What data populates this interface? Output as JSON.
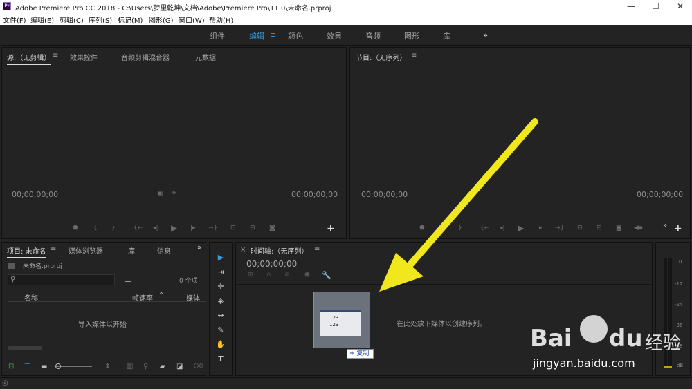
{
  "titlebar": {
    "title": "Adobe Premiere Pro CC 2018 - C:\\Users\\梦里乾坤\\文档\\Adobe\\Premiere Pro\\11.0\\未命名.prproj",
    "minimize": "—",
    "maximize": "☐",
    "close": "✕",
    "app_icon": "Pr"
  },
  "menu": {
    "items": [
      "文件(F)",
      "编辑(E)",
      "剪辑(C)",
      "序列(S)",
      "标记(M)",
      "图形(G)",
      "窗口(W)",
      "帮助(H)"
    ]
  },
  "workspaces": {
    "items": [
      "组件",
      "编辑",
      "颜色",
      "效果",
      "音频",
      "图形",
      "库"
    ],
    "active_index": 1,
    "more": "»",
    "menu_glyph": "≡"
  },
  "source_panel": {
    "tabs": [
      "源:（无剪辑）",
      "效果控件",
      "音频剪辑混合器",
      "元数据"
    ],
    "timecode_left": "00;00;00;00",
    "timecode_right": "00;00;00;00",
    "add": "+"
  },
  "program_panel": {
    "title": "节目:（无序列）",
    "timecode_left": "00;00;00;00",
    "timecode_right": "00;00;00;00",
    "add": "+",
    "more": "»"
  },
  "project_panel": {
    "tabs": [
      "项目: 未命名",
      "媒体浏览器",
      "库",
      "信息"
    ],
    "file": "未命名.prproj",
    "item_count": "0 个项",
    "col_name": "名称",
    "col_fps": "帧速率",
    "col_media": "媒体",
    "empty_text": "导入媒体以开始",
    "more": "»"
  },
  "timeline_panel": {
    "close": "×",
    "title": "时间轴:（无序列）",
    "timecode": "00;00;00;00",
    "drop_text": "在此处放下媒体以创建序列。",
    "drag_thumb_lines": [
      "123",
      "123"
    ],
    "copy_badge": "复制",
    "copy_plus": "+"
  },
  "audio_meter": {
    "labels": [
      "0",
      "-12",
      "-24",
      "-36",
      "-48",
      "dB"
    ]
  },
  "watermark": {
    "brand": "Bai",
    "brand2": "du",
    "cn": "经验",
    "url": "jingyan.baidu.com"
  },
  "colors": {
    "accent": "#3a9bd9",
    "arrow": "#f0e81c",
    "panel_bg": "#232323"
  }
}
